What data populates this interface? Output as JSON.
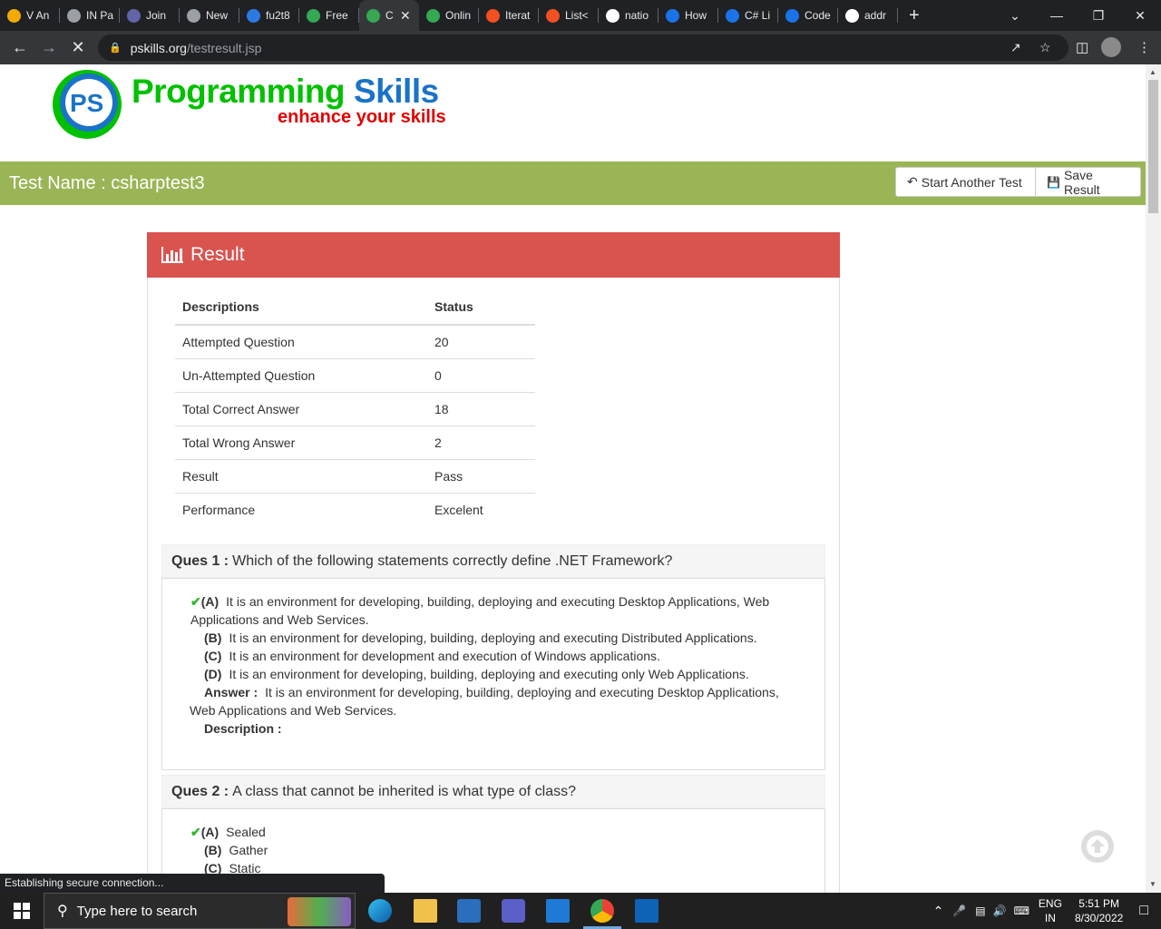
{
  "browser": {
    "tabs": [
      {
        "title": "V An",
        "icon": "outlook-icon",
        "color": "#f2a900"
      },
      {
        "title": "IN Pa",
        "icon": "globe-icon",
        "color": "#9aa0a6"
      },
      {
        "title": "Join",
        "icon": "teams-icon",
        "color": "#6264a7"
      },
      {
        "title": "New",
        "icon": "chatgpt-icon",
        "color": "#9aa0a6"
      },
      {
        "title": "fu2t8",
        "icon": "ce-icon",
        "color": "#2a7ae2"
      },
      {
        "title": "Free",
        "icon": "green-circle-icon",
        "color": "#34a853"
      },
      {
        "title": "C",
        "icon": "green-circle-icon",
        "color": "#34a853"
      },
      {
        "title": "Onlin",
        "icon": "green-circle-icon",
        "color": "#34a853"
      },
      {
        "title": "Iterat",
        "icon": "microsoft-icon",
        "color": "#f25022"
      },
      {
        "title": "List<",
        "icon": "microsoft-icon",
        "color": "#f25022"
      },
      {
        "title": "natio",
        "icon": "google-icon",
        "color": "#ffffff"
      },
      {
        "title": "How",
        "icon": "t-icon",
        "color": "#1a73e8"
      },
      {
        "title": "C# Li",
        "icon": "t-icon",
        "color": "#1a73e8"
      },
      {
        "title": "Code",
        "icon": "t-icon",
        "color": "#1a73e8"
      },
      {
        "title": "addr",
        "icon": "google-icon",
        "color": "#ffffff"
      }
    ],
    "active_tab_index": 6,
    "url_domain": "pskills.org",
    "url_path": "/testresult.jsp"
  },
  "site": {
    "brand_part1": "Programming",
    "brand_part2": "Skills",
    "tagline": "enhance your skills",
    "logo_text": "PS"
  },
  "header": {
    "test_name": "Test Name : csharptest3",
    "start_another_label": "Start Another Test",
    "save_result_label": "Save Result"
  },
  "result": {
    "title": "Result",
    "columns": [
      "Descriptions",
      "Status"
    ],
    "rows": [
      [
        "Attempted Question",
        "20"
      ],
      [
        "Un-Attempted Question",
        "0"
      ],
      [
        "Total Correct Answer",
        "18"
      ],
      [
        "Total Wrong Answer",
        "2"
      ],
      [
        "Result",
        "Pass"
      ],
      [
        "Performance",
        "Excelent"
      ]
    ]
  },
  "questions": [
    {
      "label": "Ques 1 :",
      "text": "Which of the following statements correctly define .NET Framework?",
      "options": [
        {
          "key": "(A)",
          "text": "It is an environment for developing, building, deploying and executing Desktop Applications, Web Applications and Web Services.",
          "correct": true
        },
        {
          "key": "(B)",
          "text": "It is an environment for developing, building, deploying and executing Distributed Applications.",
          "correct": false
        },
        {
          "key": "(C)",
          "text": "It is an environment for development and execution of Windows applications.",
          "correct": false
        },
        {
          "key": "(D)",
          "text": "It is an environment for developing, building, deploying and executing only Web Applications.",
          "correct": false
        }
      ],
      "answer_label": "Answer :",
      "answer_text": "It is an environment for developing, building, deploying and executing Desktop Applications, Web Applications and Web Services.",
      "description_label": "Description :"
    },
    {
      "label": "Ques 2 :",
      "text": "A class that cannot be inherited is what type of class?",
      "options": [
        {
          "key": "(A)",
          "text": "Sealed",
          "correct": true
        },
        {
          "key": "(B)",
          "text": "Gather",
          "correct": false
        },
        {
          "key": "(C)",
          "text": "Static",
          "correct": false
        }
      ]
    }
  ],
  "status_bar": "Establishing secure connection...",
  "taskbar": {
    "search_placeholder": "Type here to search",
    "lang1": "ENG",
    "lang2": "IN",
    "time": "5:51 PM",
    "date": "8/30/2022"
  },
  "colors": {
    "green_bar": "#9ab555",
    "result_header": "#d9534f",
    "brand_green": "#00c000",
    "brand_blue": "#1a73c8",
    "tagline_red": "#e00000"
  }
}
